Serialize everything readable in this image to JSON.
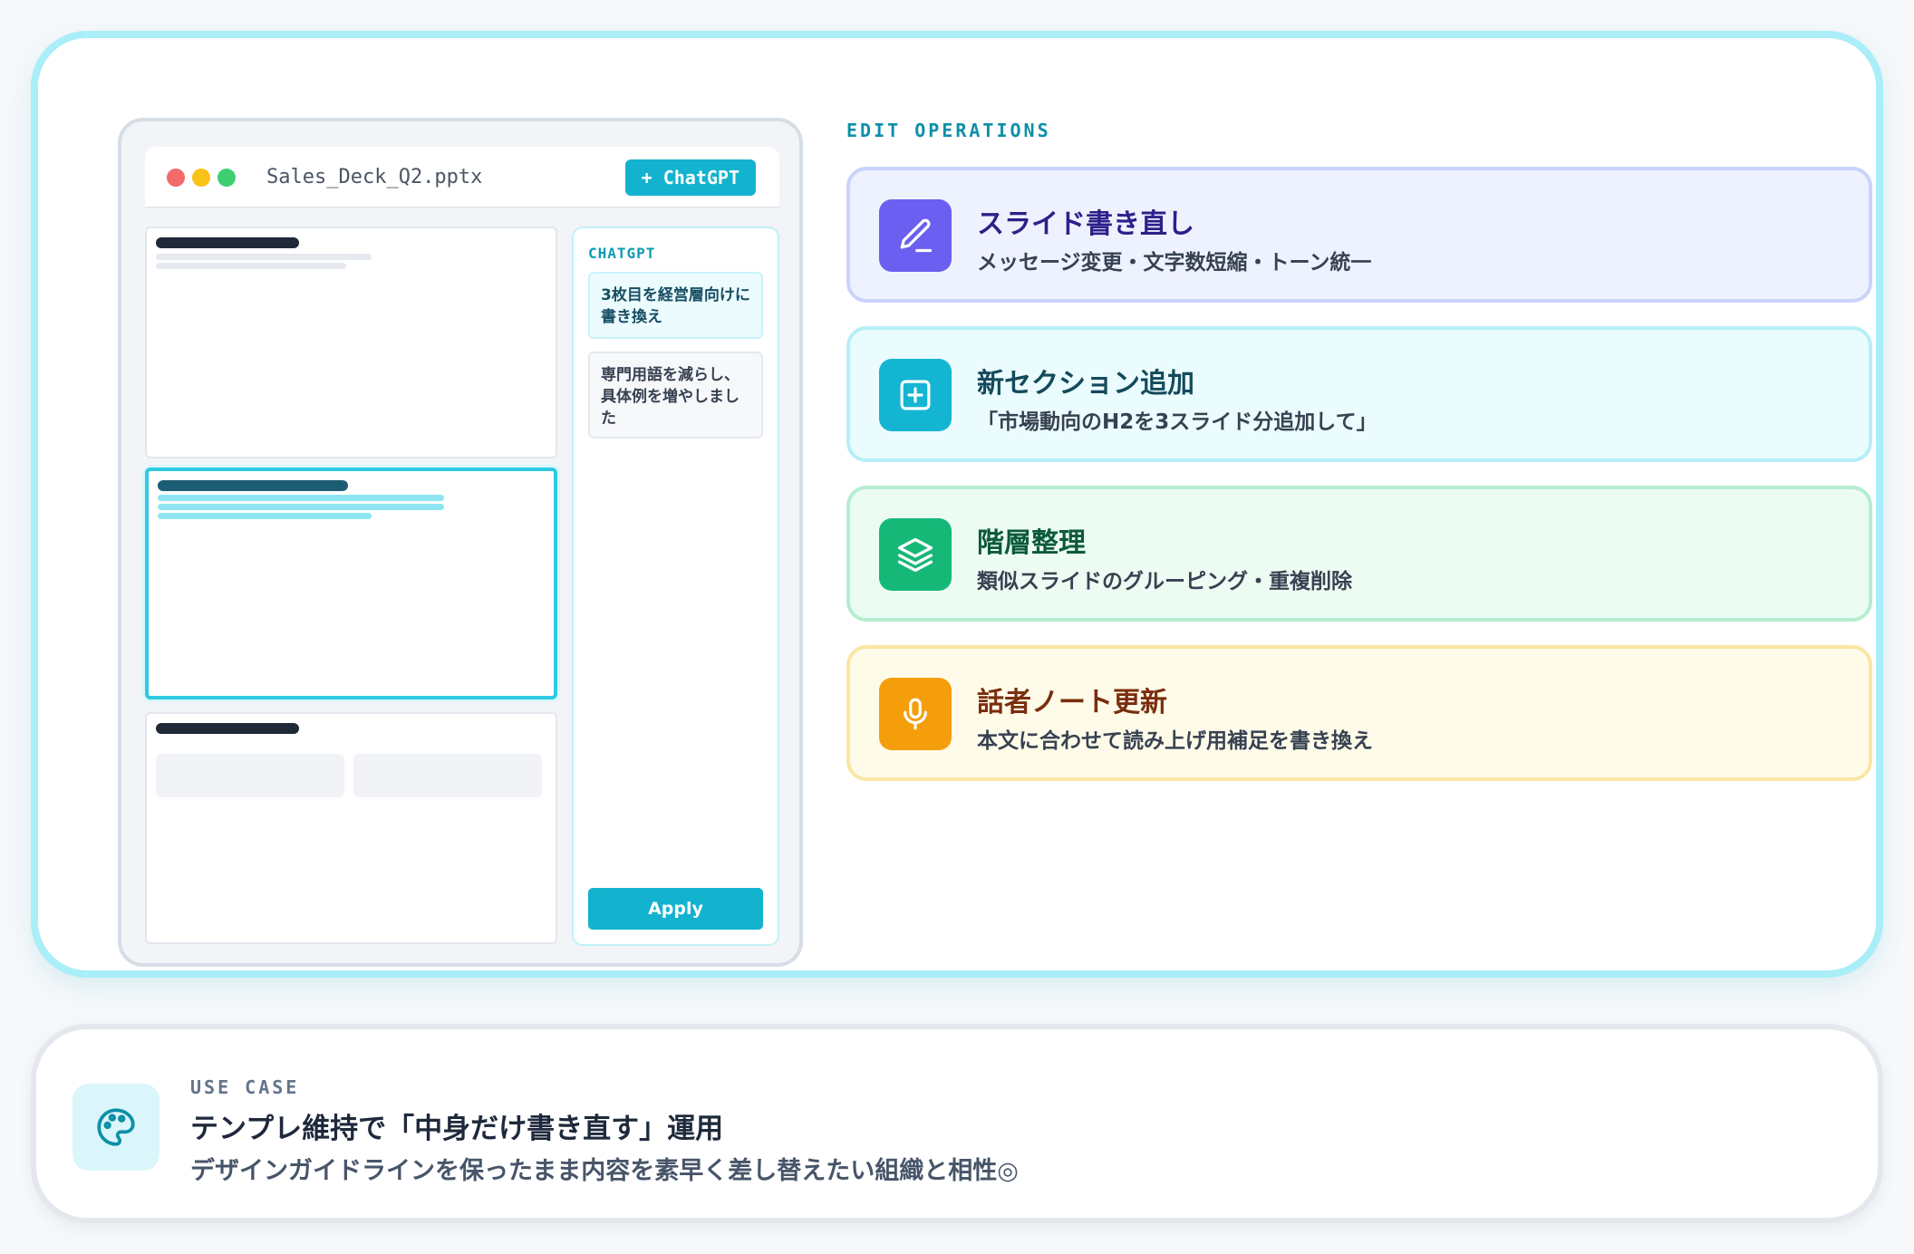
{
  "window": {
    "filename": "Sales_Deck_Q2.pptx",
    "chatgpt_button": "+ ChatGPT"
  },
  "chat": {
    "label": "CHATGPT",
    "user_message": "3枚目を経営層向けに書き換え",
    "assistant_message": "専門用語を減らし、具体例を増やしました",
    "apply_button": "Apply"
  },
  "operations": {
    "label": "EDIT OPERATIONS",
    "items": [
      {
        "title": "スライド書き直し",
        "desc": "メッセージ変更・文字数短縮・トーン統一",
        "icon": "pencil-icon",
        "color": "#6a5ff0"
      },
      {
        "title": "新セクション追加",
        "desc": "「市場動向のH2を3スライド分追加して」",
        "icon": "plus-square-icon",
        "color": "#14b5d3"
      },
      {
        "title": "階層整理",
        "desc": "類似スライドのグルーピング・重複削除",
        "icon": "layers-icon",
        "color": "#16b878"
      },
      {
        "title": "話者ノート更新",
        "desc": "本文に合わせて読み上げ用補足を書き換え",
        "icon": "microphone-icon",
        "color": "#f59e0b"
      }
    ]
  },
  "use_case": {
    "label": "USE CASE",
    "title": "テンプレ維持で「中身だけ書き直す」運用",
    "desc": "デザインガイドラインを保ったまま内容を素早く差し替えたい組織と相性◎",
    "icon": "palette-icon"
  }
}
